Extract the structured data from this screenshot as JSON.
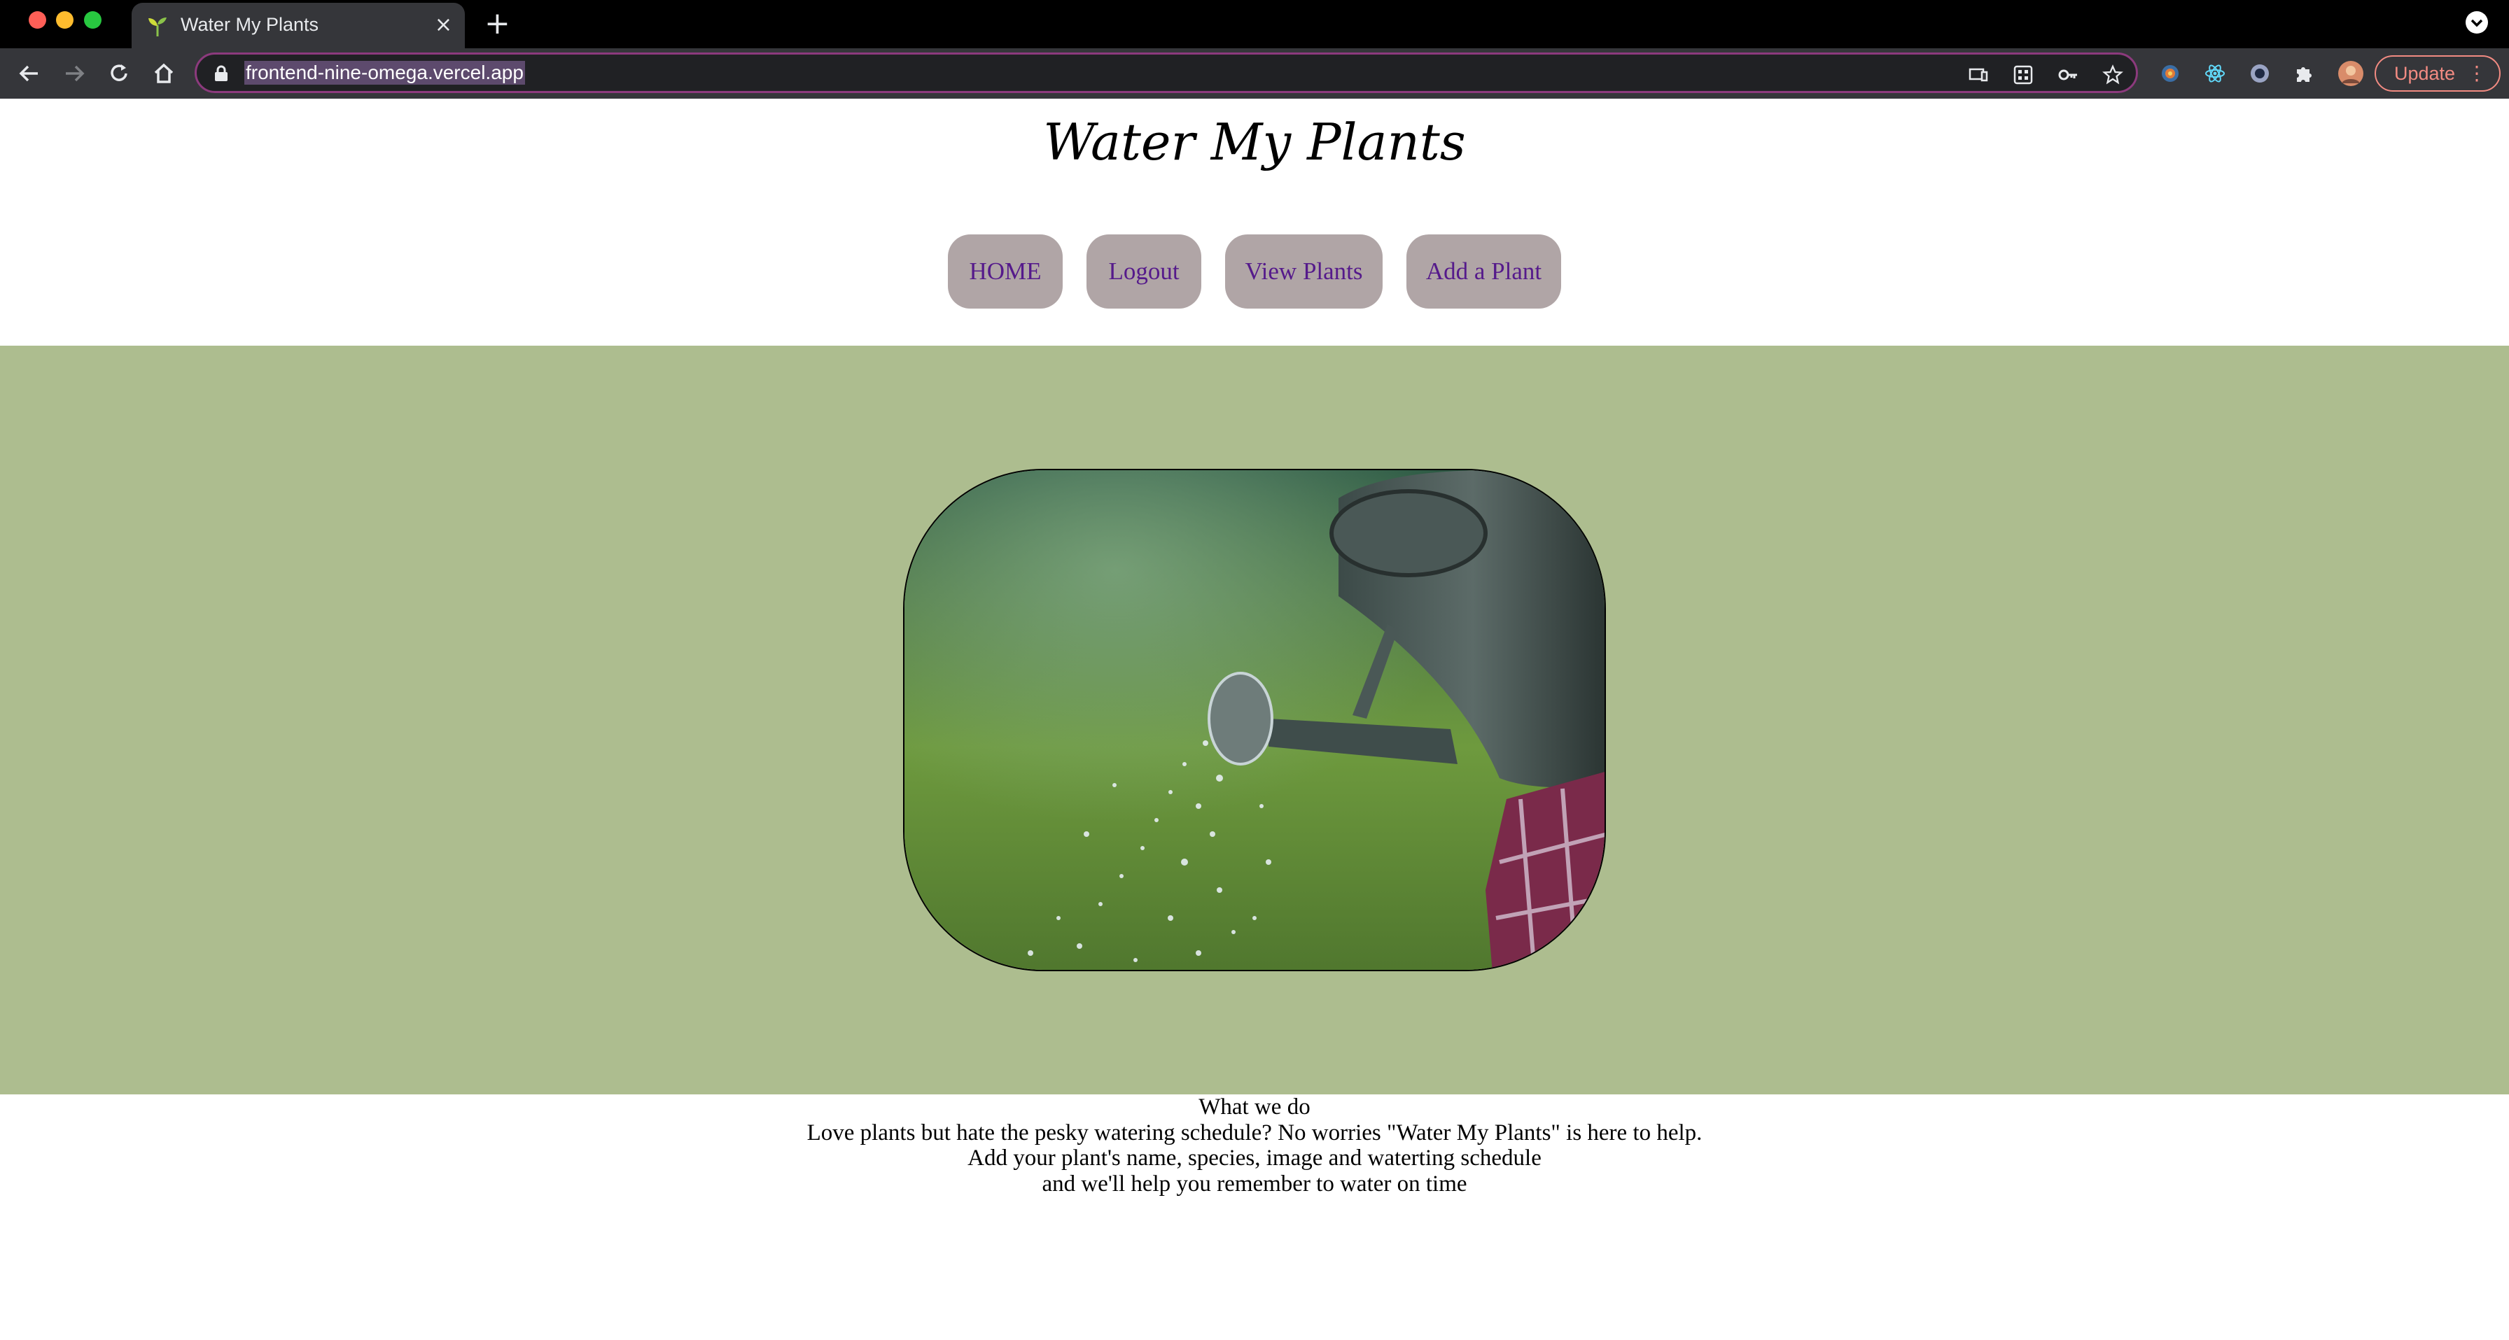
{
  "browser": {
    "tab_title": "Water My Plants",
    "tab_close": "×",
    "new_tab": "+",
    "url": "frontend-nine-omega.vercel.app",
    "update_label": "Update",
    "update_menu": "⋮"
  },
  "site": {
    "title": "Water My Plants",
    "nav": [
      "HOME",
      "Logout",
      "View Plants",
      "Add a Plant"
    ]
  },
  "about": {
    "heading": "What we do",
    "line1": "Love plants but hate the pesky watering schedule? No worries \"Water My Plants\" is here to help.",
    "line2": "Add your plant's name, species, image and waterting schedule",
    "line3": "and we'll help you remember to water on time"
  },
  "colors": {
    "hero_background": "#adbd8f",
    "nav_button": "#b0a5a6",
    "nav_link": "#551a8b"
  }
}
